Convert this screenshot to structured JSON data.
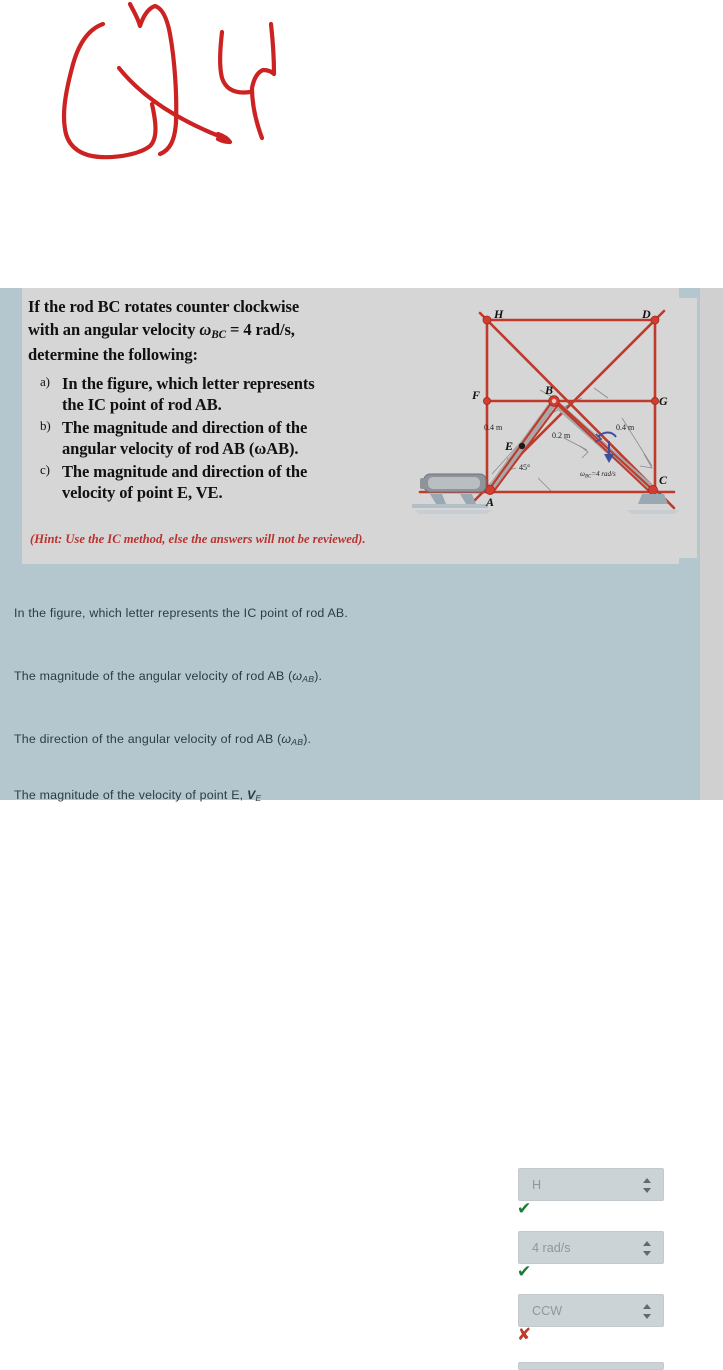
{
  "annotation": {
    "name": "handwritten-red-scribble",
    "color": "#cc2222",
    "description": "handwritten red mark resembling a looped letter and a 4"
  },
  "problem": {
    "intro_line1": "If the rod BC rotates counter clockwise",
    "intro_line2_a": "with an angular velocity ",
    "intro_line2_sym": "ω",
    "intro_line2_sub": "BC",
    "intro_line2_b": " = 4 rad/s,",
    "intro_line3": "determine the following:",
    "items": [
      {
        "marker": "a)",
        "line1": "In the figure, which letter represents",
        "line2": "the IC point of rod AB."
      },
      {
        "marker": "b)",
        "line1": "The magnitude and direction of the",
        "line2": "angular velocity of rod AB (ωAB)."
      },
      {
        "marker": "c)",
        "line1": "The magnitude and direction of the",
        "line2": "velocity of point E, VE."
      }
    ],
    "hint": "(Hint: Use the IC method, else the answers will not be reviewed)."
  },
  "figure": {
    "name": "four-bar-mechanism-ic-diagram",
    "points": [
      "H",
      "D",
      "F",
      "B",
      "G",
      "E",
      "A",
      "C"
    ],
    "dim_left": "0.4 m",
    "dim_mid": "0.2 m",
    "dim_right": "0.4 m",
    "angle": "45°",
    "omega_label": "ωBC=4 rad/s",
    "line_color": "#c0392b",
    "bg": "#d6d6d6"
  },
  "answers": {
    "rows": [
      {
        "label_pre": "In the figure, which letter represents the IC point of rod AB.",
        "label_post": "",
        "value": "H",
        "status": "correct",
        "status_glyph": "✔"
      },
      {
        "label_pre": "The magnitude of the angular velocity of rod AB (",
        "label_sym": "ω",
        "label_sub": "AB",
        "label_post": ").",
        "value": "4 rad/s",
        "status": "correct",
        "status_glyph": "✔"
      },
      {
        "label_pre": "The direction of the angular velocity of rod AB (",
        "label_sym": "ω",
        "label_sub": "AB",
        "label_post": ").",
        "value": "CCW",
        "status": "incorrect",
        "status_glyph": "✘"
      },
      {
        "label_pre": "The magnitude of the velocity of point E, ",
        "label_sym": "V",
        "label_sub": "E",
        "label_post": "",
        "value": "",
        "status": "",
        "status_glyph": ""
      }
    ]
  },
  "colors": {
    "page_bg": "#ffffff",
    "panel_bg": "#b4c6ce",
    "image_bg": "#d6d6d6",
    "accent_red": "#c0392b",
    "correct_green": "#1f7a33",
    "incorrect_red": "#c0392b",
    "text": "#2d3b44"
  }
}
